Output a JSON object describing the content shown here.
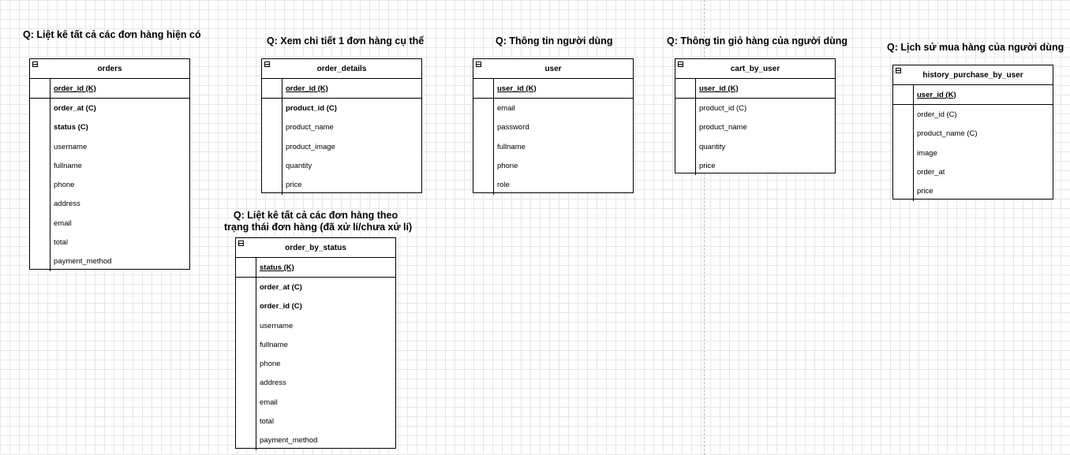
{
  "queries": {
    "orders": "Q: Liệt kê tất cả các đơn hàng hiện có",
    "order_details": "Q: Xem chi tiết 1 đơn hàng cụ thể",
    "user": "Q: Thông tin người dùng",
    "cart_by_user": "Q: Thông tin giỏ hàng của người dùng",
    "history_purchase_by_user": "Q: Lịch sử mua hàng của người dùng",
    "order_by_status_line1": "Q: Liệt kê tất cả các đơn hàng theo",
    "order_by_status_line2": "trạng thái đơn hàng (đã xử lí/chưa xử lí)"
  },
  "tables": {
    "orders": {
      "name": "orders",
      "key": "order_id (K)",
      "columns": [
        "order_at (C)",
        "status (C)",
        "username",
        "fullname",
        "phone",
        "address",
        "email",
        "total",
        "payment_method"
      ]
    },
    "order_details": {
      "name": "order_details",
      "key": "order_id (K)",
      "columns": [
        "product_id (C)",
        "product_name",
        "product_image",
        "quantity",
        "price"
      ]
    },
    "user": {
      "name": "user",
      "key": "user_id (K)",
      "columns": [
        "email",
        "password",
        "fullname",
        "phone",
        "role"
      ]
    },
    "cart_by_user": {
      "name": "cart_by_user",
      "key": "user_id (K)",
      "columns": [
        "product_id (C)",
        "product_name",
        "quantity",
        "price"
      ]
    },
    "history_purchase_by_user": {
      "name": "history_purchase_by_user",
      "key": "user_id (K)",
      "columns": [
        "order_id (C)",
        "product_name (C)",
        "image",
        "order_at",
        "price"
      ]
    },
    "order_by_status": {
      "name": "order_by_status",
      "key": "status (K)",
      "columns": [
        "order_at (C)",
        "order_id (C)",
        "username",
        "fullname",
        "phone",
        "address",
        "email",
        "total",
        "payment_method"
      ]
    }
  },
  "icons": {
    "collapse": "collapse-icon"
  }
}
